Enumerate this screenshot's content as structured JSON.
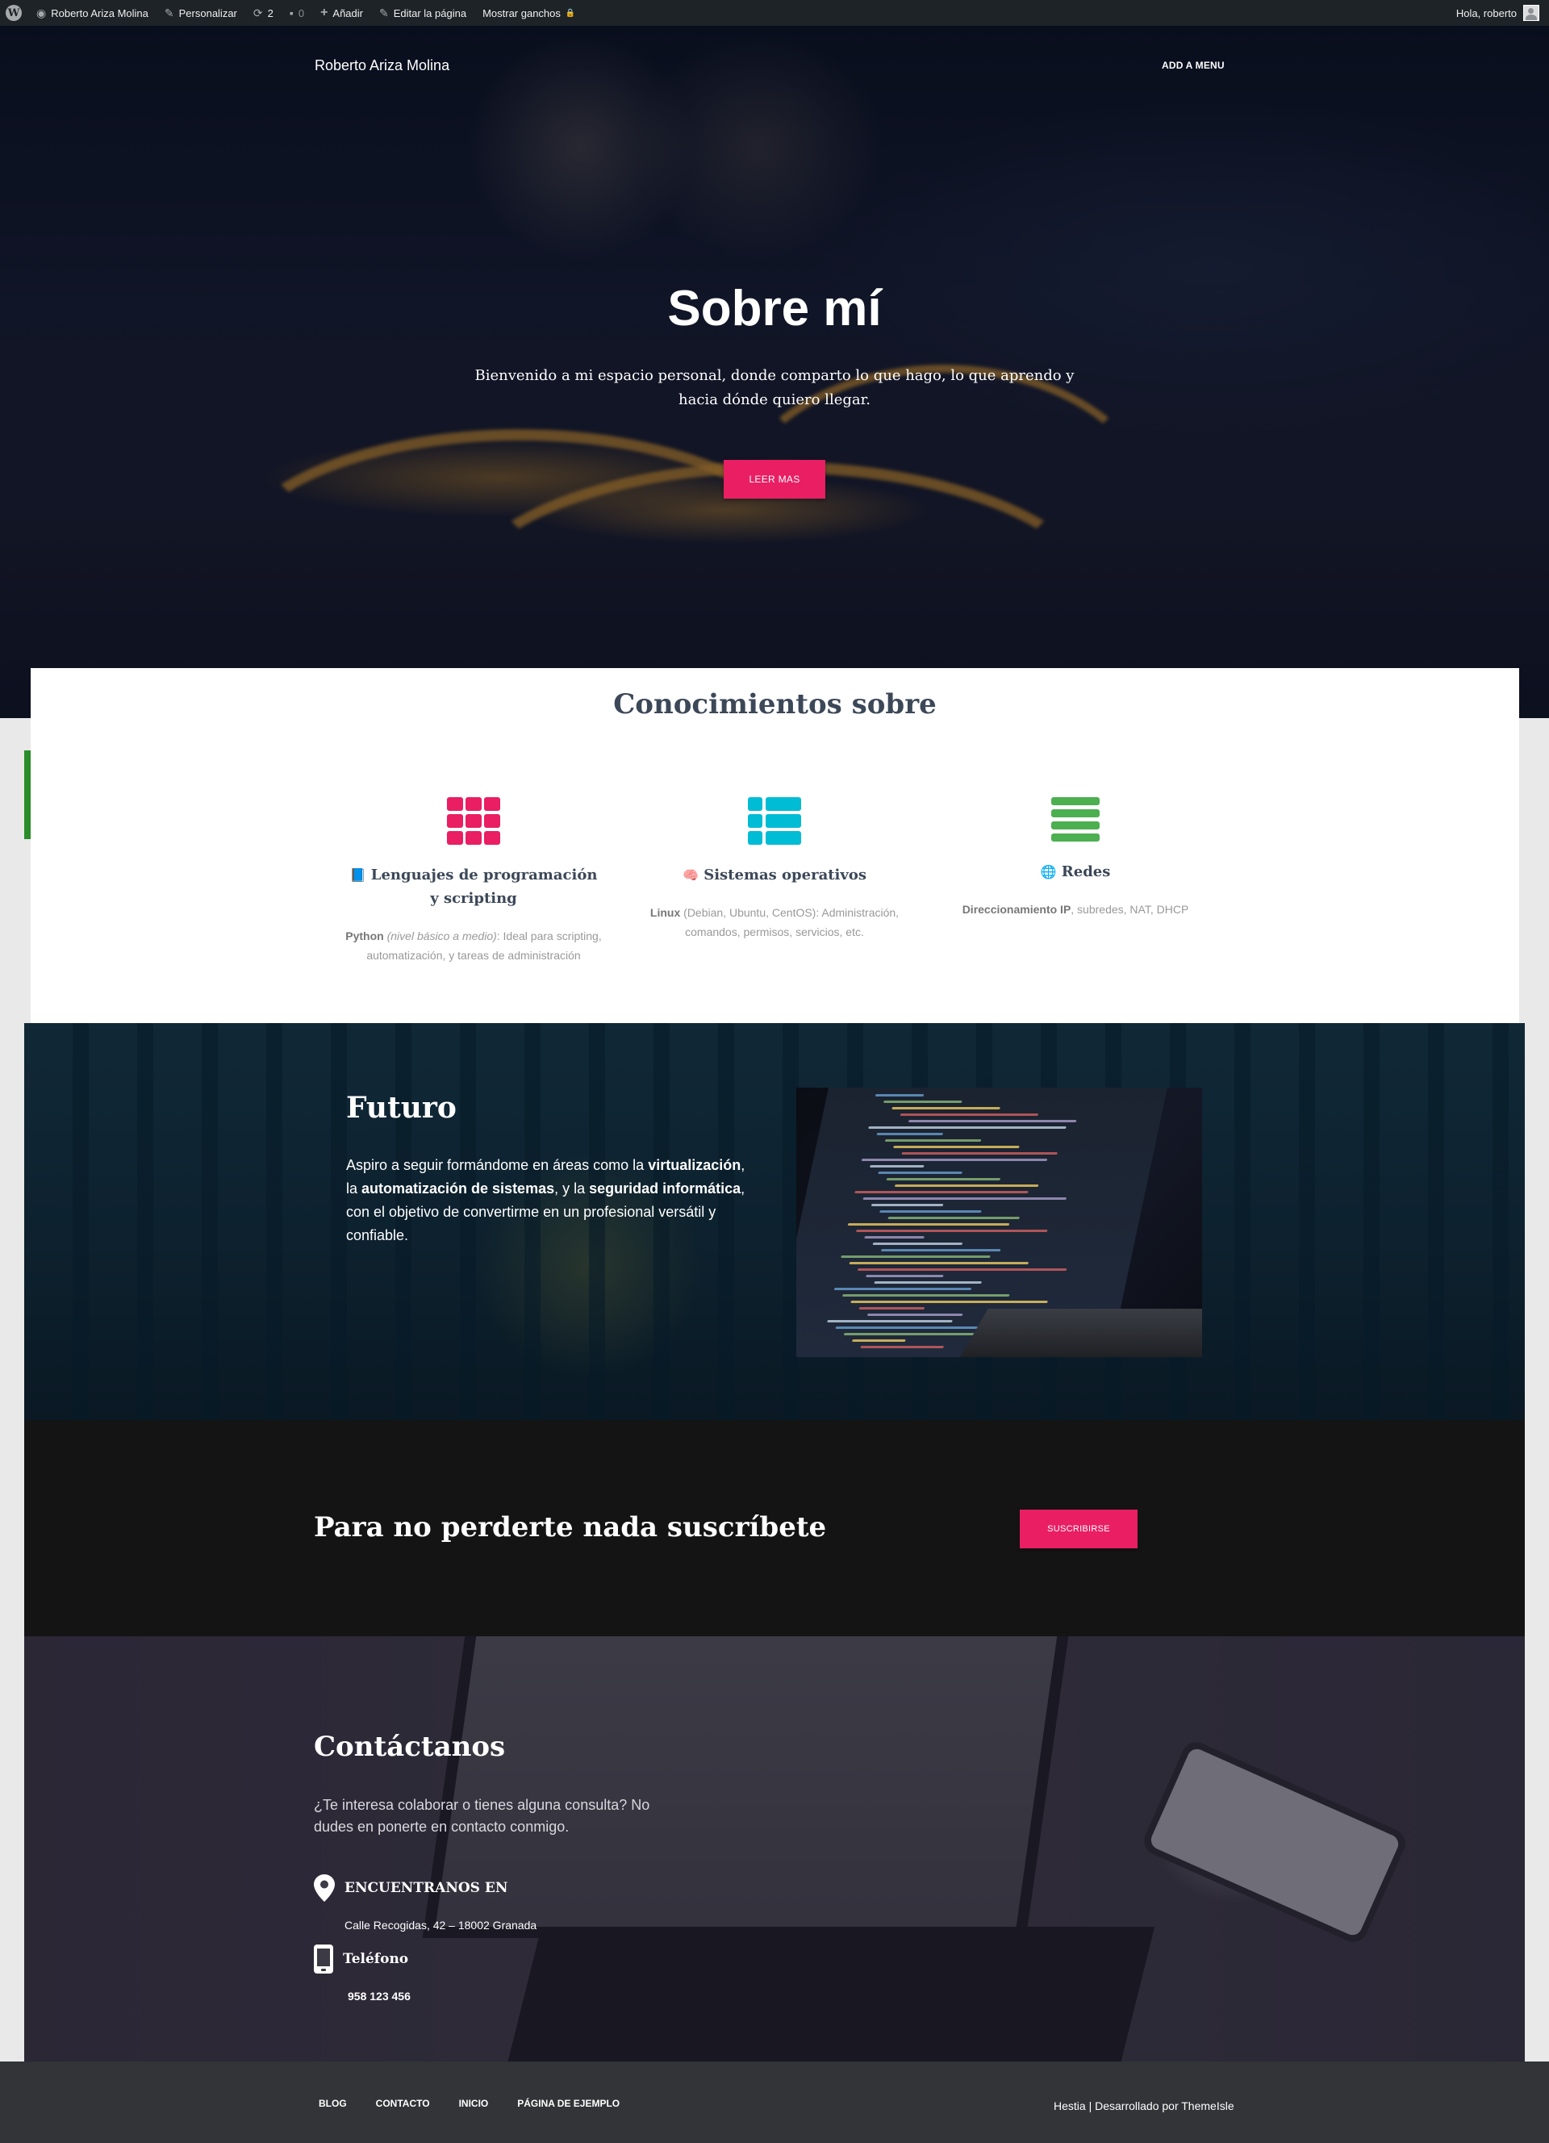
{
  "admin_bar": {
    "site_name": "Roberto Ariza Molina",
    "customize": "Personalizar",
    "updates_count": "2",
    "comments_count": "0",
    "add_new": "Añadir",
    "edit_page": "Editar la página",
    "show_hooks": "Mostrar ganchos",
    "greeting": "Hola, roberto"
  },
  "header": {
    "site_title": "Roberto Ariza Molina",
    "menu_link": "ADD A MENU"
  },
  "hero": {
    "title": "Sobre mí",
    "subtitle": "Bienvenido a mi espacio personal, donde comparto lo que hago, lo que aprendo y hacia dónde quiero llegar.",
    "button": "LEER MAS"
  },
  "features": {
    "title": "Conocimientos sobre",
    "items": [
      {
        "icon": "grid-icon",
        "color": "#e91e63",
        "emoji": "📘",
        "heading": "Lenguajes de programación y scripting",
        "bold": "Python",
        "italic": "(nivel básico a medio)",
        "text": ": Ideal para scripting, automatización, y tareas de administración"
      },
      {
        "icon": "table-list-icon",
        "color": "#00bcd4",
        "emoji": "🧠",
        "heading": "Sistemas operativos",
        "bold": "Linux",
        "text": " (Debian, Ubuntu, CentOS): Administración, comandos, permisos, servicios, etc."
      },
      {
        "icon": "bars-icon",
        "color": "#4caf50",
        "emoji": "🌐",
        "heading": "Redes",
        "bold": "Direccionamiento IP",
        "text": ", subredes, NAT, DHCP"
      }
    ]
  },
  "futuro": {
    "title": "Futuro",
    "p1": "Aspiro a seguir formándome en áreas como la ",
    "b1": "virtualización",
    "p2": ", la ",
    "b2": "automatización de sistemas",
    "p3": ", y la ",
    "b3": "seguridad informática",
    "p4": ", con el objetivo de convertirme en un profesional versátil y confiable."
  },
  "subscribe": {
    "title": "Para no perderte nada suscríbete",
    "button": "SUSCRIBIRSE"
  },
  "contact": {
    "title": "Contáctanos",
    "text": "¿Te interesa colaborar o tienes alguna consulta? No dudes en ponerte en contacto conmigo.",
    "location_title": "ENCUENTRANOS EN",
    "address": "Calle Recogidas, 42 – 18002 Granada",
    "phone_title": "Teléfono",
    "phone": "958 123 456"
  },
  "footer": {
    "links": [
      "BLOG",
      "CONTACTO",
      "INICIO",
      "PÁGINA DE EJEMPLO"
    ],
    "credit_brand": "Hestia",
    "credit_sep": " | Desarrollado por ",
    "credit_author": "ThemeIsle"
  },
  "colors": {
    "accent": "#e91e63",
    "admin_bar": "#1d2327",
    "footer": "#323437"
  }
}
